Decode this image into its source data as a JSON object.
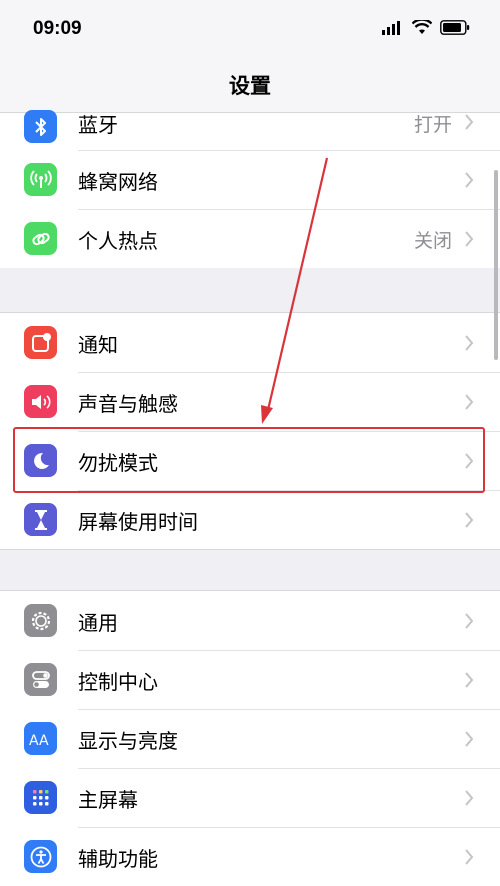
{
  "status": {
    "time": "09:09"
  },
  "nav": {
    "title": "设置"
  },
  "groups": [
    {
      "rows": [
        {
          "label": "蓝牙",
          "value": "打开",
          "icon": "bluetooth-icon",
          "color": "#2f7cf6"
        },
        {
          "label": "蜂窝网络",
          "value": "",
          "icon": "cellular-antenna-icon",
          "color": "#4cd964"
        },
        {
          "label": "个人热点",
          "value": "关闭",
          "icon": "hotspot-link-icon",
          "color": "#4cd964"
        }
      ]
    },
    {
      "rows": [
        {
          "label": "通知",
          "icon": "notifications-icon",
          "color": "#f0493e"
        },
        {
          "label": "声音与触感",
          "icon": "speaker-icon",
          "color": "#ef3d5f"
        },
        {
          "label": "勿扰模式",
          "icon": "moon-icon",
          "color": "#5b5bd6"
        },
        {
          "label": "屏幕使用时间",
          "icon": "hourglass-icon",
          "color": "#5b5bd6"
        }
      ]
    },
    {
      "rows": [
        {
          "label": "通用",
          "icon": "gear-icon",
          "color": "#8e8e93"
        },
        {
          "label": "控制中心",
          "icon": "toggles-icon",
          "color": "#8e8e93"
        },
        {
          "label": "显示与亮度",
          "icon": "text-size-icon",
          "color": "#2f7cf6"
        },
        {
          "label": "主屏幕",
          "icon": "home-grid-icon",
          "color": "#2f5fe0"
        },
        {
          "label": "辅助功能",
          "icon": "accessibility-icon",
          "color": "#2f7cf6"
        }
      ]
    }
  ],
  "annotation": {
    "color": "#d9343a",
    "target": "勿扰模式"
  }
}
